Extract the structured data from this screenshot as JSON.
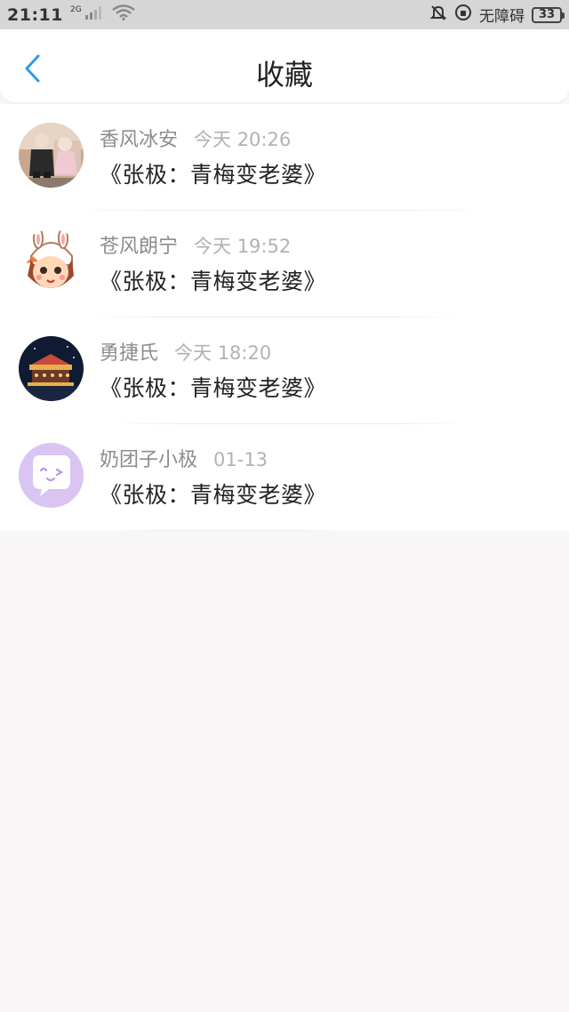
{
  "status_bar": {
    "time": "21:11",
    "network": "2G",
    "accessibility": "无障碍",
    "battery": "33"
  },
  "header": {
    "title": "收藏",
    "back_icon": "chevron-left-icon"
  },
  "favorites": [
    {
      "username": "香风冰安",
      "timestamp": "今天 20:26",
      "content": "《张极：青梅变老婆》"
    },
    {
      "username": "苍风朗宁",
      "timestamp": "今天 19:52",
      "content": "《张极：青梅变老婆》"
    },
    {
      "username": "勇捷氏",
      "timestamp": "今天 18:20",
      "content": "《张极：青梅变老婆》"
    },
    {
      "username": "奶团子小极",
      "timestamp": "01-13",
      "content": "《张极：青梅变老婆》"
    }
  ],
  "colors": {
    "accent": "#2b9bf0",
    "background": "#f8f6f7"
  }
}
